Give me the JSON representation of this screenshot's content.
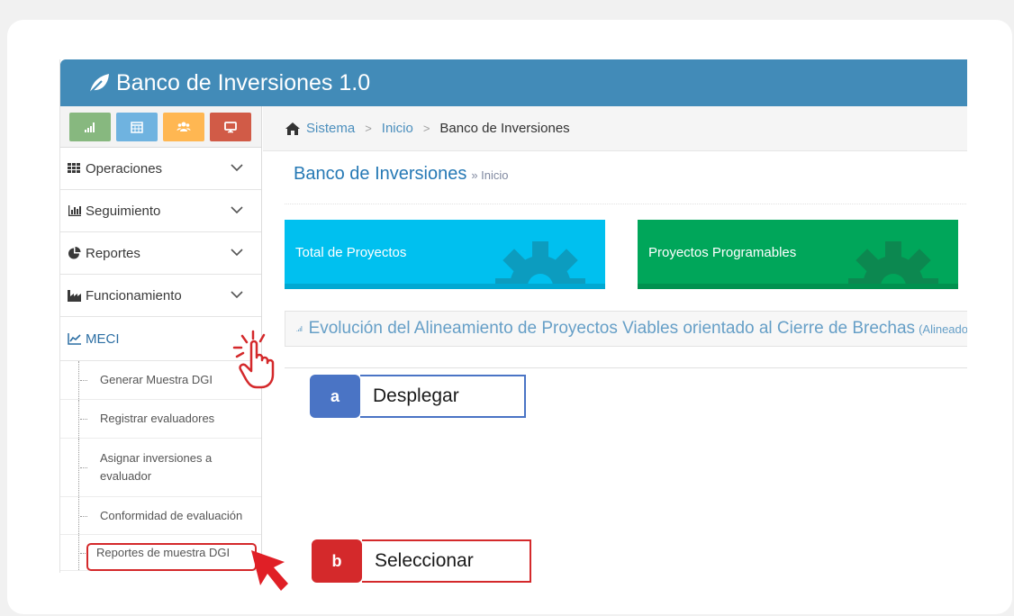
{
  "app": {
    "title": "Banco de Inversiones 1.0"
  },
  "colors": {
    "topbar": "#428bb8",
    "shortcut_green": "#87b87f",
    "shortcut_blue": "#6fb3e0",
    "shortcut_orange": "#ffb752",
    "shortcut_red": "#d15b47",
    "box_total": "#00c0ef",
    "box_programables": "#00a65a",
    "callout_a": "#4a74c5",
    "callout_b": "#d4292b"
  },
  "shortcuts": [
    {
      "icon": "bar-chart-icon",
      "color": "green"
    },
    {
      "icon": "calendar-icon",
      "color": "blue"
    },
    {
      "icon": "users-icon",
      "color": "orange"
    },
    {
      "icon": "monitor-icon",
      "color": "red"
    }
  ],
  "sidebar": {
    "items": [
      {
        "label": "Operaciones",
        "icon": "grid-icon"
      },
      {
        "label": "Seguimiento",
        "icon": "bar-chart-icon"
      },
      {
        "label": "Reportes",
        "icon": "pie-chart-icon"
      },
      {
        "label": "Funcionamiento",
        "icon": "industry-icon"
      },
      {
        "label": "MECI",
        "icon": "line-chart-icon"
      }
    ],
    "meci_submenu": [
      "Generar Muestra DGI",
      "Registrar evaluadores",
      "Asignar inversiones a evaluador",
      "Conformidad de evaluación",
      "Reportes de muestra DGI"
    ]
  },
  "breadcrumb": {
    "items": [
      "Sistema",
      "Inicio",
      "Banco de Inversiones"
    ]
  },
  "page": {
    "title": "Banco de Inversiones",
    "subtitle": "» Inicio"
  },
  "boxes": [
    {
      "label": "Total de Proyectos"
    },
    {
      "label": "Proyectos Programables"
    }
  ],
  "panel": {
    "title": "Evolución del Alineamiento de Proyectos Viables orientado al Cierre de Brechas",
    "suffix": "(Alineado"
  },
  "callouts": [
    {
      "tag": "a",
      "text": "Desplegar"
    },
    {
      "tag": "b",
      "text": "Seleccionar"
    }
  ]
}
